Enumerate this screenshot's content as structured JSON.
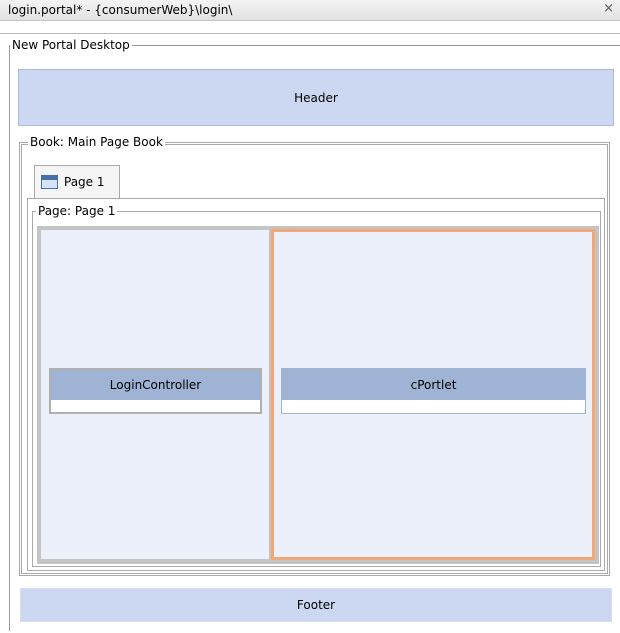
{
  "window": {
    "title": "login.portal* - {consumerWeb}\\login\\",
    "close_glyph": "×"
  },
  "desktop": {
    "legend": "New Portal Desktop",
    "header_label": "Header",
    "footer_label": "Footer"
  },
  "book": {
    "legend": "Book: Main Page Book",
    "tabs": [
      {
        "label": "Page 1",
        "icon": "calendar-icon"
      }
    ]
  },
  "page": {
    "legend": "Page: Page 1",
    "columns": [
      {
        "portlet_title": "LoginController",
        "selected": false
      },
      {
        "portlet_title": "cPortlet",
        "selected": true
      }
    ]
  },
  "colors": {
    "bar_fill": "#ccd8f2",
    "portlet_title_fill": "#9fb3d4",
    "column_fill": "#ebf0fa",
    "selection_border": "#f0a878"
  }
}
